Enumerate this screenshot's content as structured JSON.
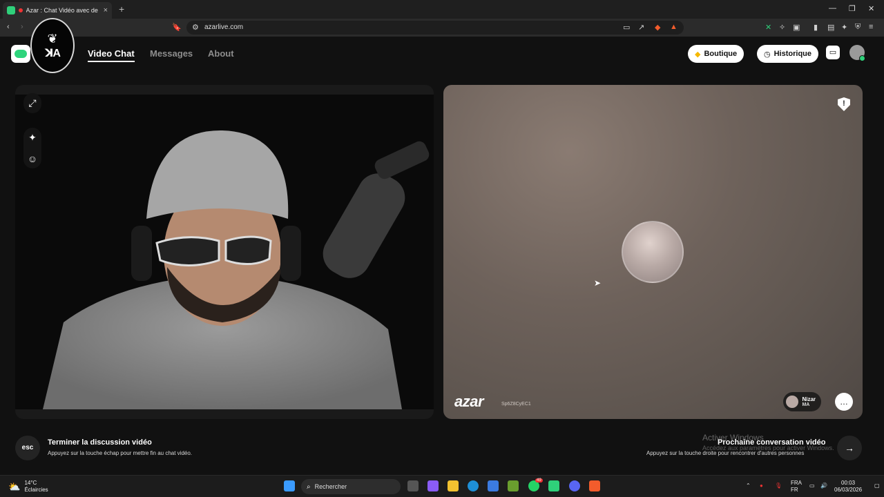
{
  "browser": {
    "tab_title": "Azar : Chat Vidéo avec de no",
    "url": "azarlive.com",
    "new_tab": "+",
    "tab_close": "×"
  },
  "header": {
    "nav": [
      "Video Chat",
      "Messages",
      "About"
    ],
    "shop_label": "Boutique",
    "history_label": "Historique"
  },
  "remote": {
    "wordmark": "azar",
    "session_id": "Sp6Z8CyEC1",
    "partner_name": "Nizar",
    "partner_country": "MA"
  },
  "controls": {
    "esc_key": "esc",
    "end_title": "Terminer la discussion vidéo",
    "end_sub": "Appuyez sur la touche échap pour mettre fin au chat vidéo.",
    "next_title": "Prochaine conversation vidéo",
    "next_sub": "Appuyez sur la touche droite pour rencontrer d'autres personnes",
    "next_arrow": "→"
  },
  "os_overlay": {
    "activation_title": "Activer Windows",
    "activation_sub": "Accédez aux paramètres pour activer Windows."
  },
  "taskbar": {
    "temp": "14°C",
    "weather": "Éclaircies",
    "search_placeholder": "Rechercher",
    "lang1": "FRA",
    "lang2": "FR",
    "time": "00:03",
    "date": "06/03/2026",
    "badge_whatsapp": "49"
  },
  "colors": {
    "accent": "#2fd07a",
    "background": "#111111",
    "remote_bg": "#6e625b"
  }
}
